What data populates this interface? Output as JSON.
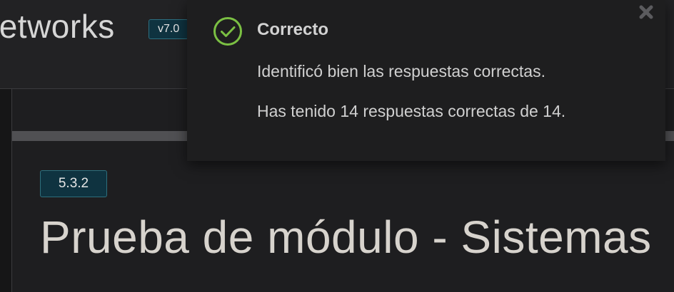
{
  "header": {
    "brand_title": "letworks",
    "version": "v7.0"
  },
  "module": {
    "chip": "5.3.2",
    "title": "Prueba de módulo - Sistemas"
  },
  "toast": {
    "icon": "check-circle-icon",
    "title": "Correcto",
    "line1": "Identificó bien las respuestas correctas.",
    "line2": "Has tenido 14 respuestas correctas de 14.",
    "close_icon": "close-icon"
  },
  "colors": {
    "success": "#7bc043",
    "accent_badge": "#0f3340",
    "background": "#1c1c1e"
  }
}
